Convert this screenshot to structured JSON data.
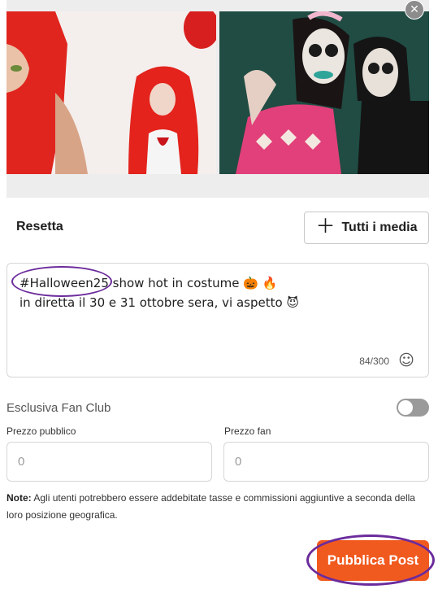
{
  "media": {
    "items": [
      {
        "description": "red-wig-costume-photo"
      },
      {
        "description": "sugar-skull-couple-photo"
      }
    ],
    "close_icon": "close-icon"
  },
  "toolbar": {
    "reset_label": "Resetta",
    "all_media_label": "Tutti i media",
    "all_media_icon": "plus-icon"
  },
  "caption": {
    "text": "#Halloween25 show hot in costume 🎃 🔥\nin diretta il 30 e 31 ottobre sera, vi aspetto 😈",
    "counter": "84/300",
    "emoji_icon": "smiley-icon"
  },
  "fan_club": {
    "label": "Esclusiva Fan Club",
    "enabled": false
  },
  "prices": {
    "public_label": "Prezzo pubblico",
    "public_placeholder": "0",
    "fan_label": "Prezzo fan",
    "fan_placeholder": "0"
  },
  "note": {
    "prefix": "Note:",
    "text": " Agli utenti potrebbero essere addebitate tasse e commissioni aggiuntive a seconda della loro posizione geografica."
  },
  "publish": {
    "label": "Pubblica Post",
    "color": "#f15a1f"
  },
  "annotation": {
    "ring_color": "#6b2b9c"
  }
}
